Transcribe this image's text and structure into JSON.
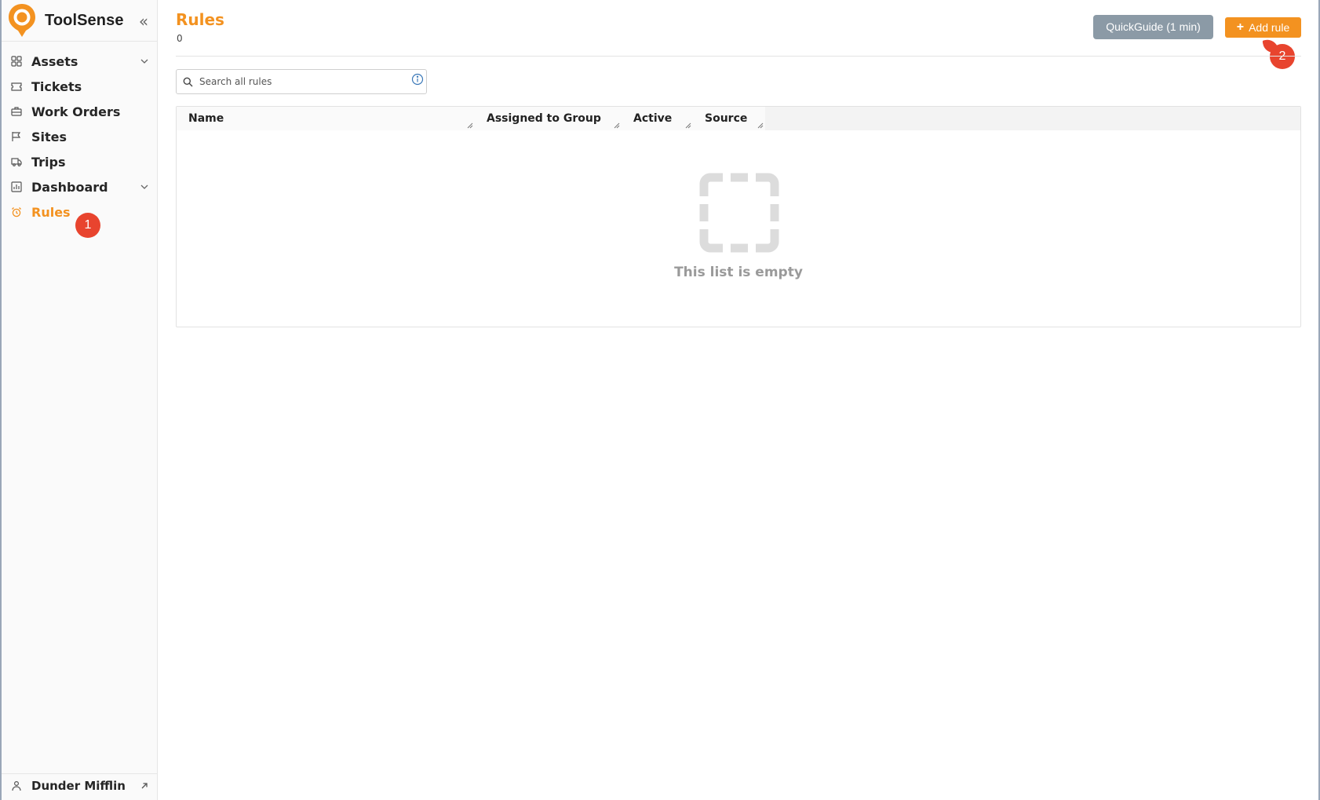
{
  "app": {
    "name": "ToolSense",
    "collapse_glyph": "«"
  },
  "colors": {
    "accent": "#f39220",
    "badge": "#e8442e",
    "guide_button": "#8b9aa6"
  },
  "sidebar": {
    "items": [
      {
        "label": "Assets",
        "icon": "grid-icon",
        "has_chevron": true
      },
      {
        "label": "Tickets",
        "icon": "ticket-icon",
        "has_chevron": false
      },
      {
        "label": "Work Orders",
        "icon": "briefcase-icon",
        "has_chevron": false
      },
      {
        "label": "Sites",
        "icon": "flag-icon",
        "has_chevron": false
      },
      {
        "label": "Trips",
        "icon": "truck-icon",
        "has_chevron": false
      },
      {
        "label": "Dashboard",
        "icon": "chart-icon",
        "has_chevron": true
      },
      {
        "label": "Rules",
        "icon": "alarm-icon",
        "has_chevron": false,
        "active": true
      }
    ],
    "footer": {
      "label": "Dunder Mifflin",
      "icon": "org-icon"
    }
  },
  "header": {
    "title": "Rules",
    "count": "0",
    "quickguide_label": "QuickGuide (1 min)",
    "add_label": "Add rule",
    "add_glyph": "+"
  },
  "search": {
    "placeholder": "Search all rules",
    "value": ""
  },
  "table": {
    "columns": [
      "Name",
      "Assigned to Group",
      "Active",
      "Source"
    ],
    "rows": [],
    "empty_text": "This list is empty"
  },
  "annotations": [
    {
      "label": "1",
      "target": "sidebar-item-rules"
    },
    {
      "label": "2",
      "target": "add-rule-button"
    }
  ]
}
